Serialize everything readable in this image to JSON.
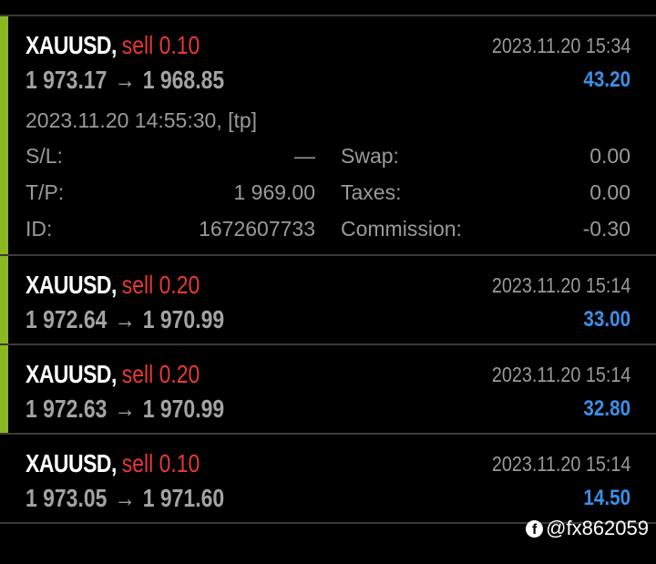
{
  "colors": {
    "background": "#000000",
    "accent_bar": "#8ab820",
    "sell": "#e53935",
    "profit": "#3d8fe8",
    "muted_text": "#9a9a9a",
    "divider": "#3a3a3a"
  },
  "trades": [
    {
      "symbol": "XAUUSD,",
      "side": "sell 0.10",
      "close_time": "2023.11.20 15:34",
      "open_price": "1 973.17",
      "arrow": "→",
      "close_price": "1 968.85",
      "profit": "43.20",
      "accent": true,
      "expanded": true,
      "details": {
        "open_info": "2023.11.20 14:55:30, [tp]",
        "sl_label": "S/L:",
        "sl_value": "—",
        "tp_label": "T/P:",
        "tp_value": "1 969.00",
        "id_label": "ID:",
        "id_value": "1672607733",
        "swap_label": "Swap:",
        "swap_value": "0.00",
        "taxes_label": "Taxes:",
        "taxes_value": "0.00",
        "commission_label": "Commission:",
        "commission_value": "-0.30"
      }
    },
    {
      "symbol": "XAUUSD,",
      "side": "sell 0.20",
      "close_time": "2023.11.20 15:14",
      "open_price": "1 972.64",
      "arrow": "→",
      "close_price": "1 970.99",
      "profit": "33.00",
      "accent": true,
      "expanded": false
    },
    {
      "symbol": "XAUUSD,",
      "side": "sell 0.20",
      "close_time": "2023.11.20 15:14",
      "open_price": "1 972.63",
      "arrow": "→",
      "close_price": "1 970.99",
      "profit": "32.80",
      "accent": true,
      "expanded": false
    },
    {
      "symbol": "XAUUSD,",
      "side": "sell 0.10",
      "close_time": "2023.11.20 15:14",
      "open_price": "1 973.05",
      "arrow": "→",
      "close_price": "1 971.60",
      "profit": "14.50",
      "accent": false,
      "expanded": false
    }
  ],
  "watermark": {
    "icon": "facebook-icon",
    "icon_glyph": "f",
    "handle": "@fx862059"
  }
}
